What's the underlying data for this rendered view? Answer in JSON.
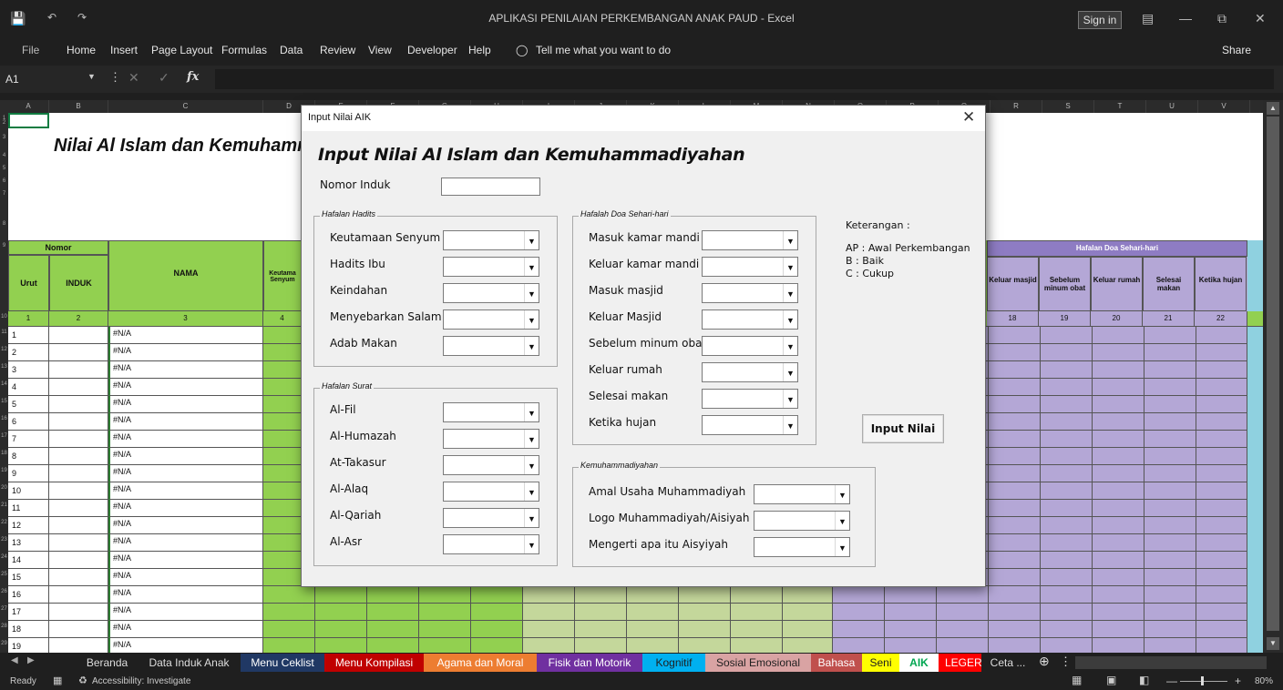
{
  "window": {
    "title": "APLIKASI PENILAIAN PERKEMBANGAN ANAK PAUD  -  Excel",
    "signin": "Sign in",
    "share": "Share"
  },
  "ribbon": {
    "tabs": [
      "File",
      "Home",
      "Insert",
      "Page Layout",
      "Formulas",
      "Data",
      "Review",
      "View",
      "Developer",
      "Help"
    ],
    "tell_me": "Tell me what you want to do"
  },
  "formula_bar": {
    "cell_ref": "A1",
    "fx": "fx"
  },
  "columns": [
    "A",
    "B",
    "C",
    "D",
    "E",
    "F",
    "G",
    "H",
    "I",
    "J",
    "K",
    "L",
    "M",
    "N",
    "O",
    "P",
    "Q",
    "R",
    "S",
    "T",
    "U",
    "V"
  ],
  "sheet": {
    "title": "Nilai Al Islam dan Kemuhammadiyahan",
    "hdr_nomor": "Nomor",
    "hdr_urut": "Urut",
    "hdr_induk": "INDUK",
    "hdr_nama": "NAMA",
    "hdr_d": "Keutama Senyum",
    "hdr_doa": "Hafalan Doa Sehari-hari",
    "doa_cols": [
      "Keluar masjid",
      "Sebelum minum obat",
      "Keluar rumah",
      "Selesai makan",
      "Ketika hujan"
    ],
    "num_row": [
      "1",
      "2",
      "3",
      "4",
      "18",
      "19",
      "20",
      "21",
      "22"
    ],
    "na_value": "#N/A",
    "row_numbers": [
      "1",
      "2",
      "3",
      "4",
      "5",
      "6",
      "7",
      "8",
      "9",
      "10",
      "11",
      "12",
      "13",
      "14",
      "15",
      "16",
      "17",
      "18",
      "19",
      "20",
      "21",
      "22",
      "23",
      "24",
      "25",
      "26",
      "27",
      "28",
      "29"
    ],
    "urut": [
      "1",
      "2",
      "3",
      "4",
      "5",
      "6",
      "7",
      "8",
      "9",
      "10",
      "11",
      "12",
      "13",
      "14",
      "15",
      "16",
      "17",
      "18",
      "19"
    ]
  },
  "tabs": [
    {
      "label": "Beranda",
      "bg": "#1f1f1f",
      "fg": "#dddddd"
    },
    {
      "label": "Data Induk Anak",
      "bg": "#1f1f1f",
      "fg": "#dddddd"
    },
    {
      "label": "Menu Ceklist",
      "bg": "#203864",
      "fg": "#ffffff"
    },
    {
      "label": "Menu Kompilasi",
      "bg": "#c00000",
      "fg": "#ffffff"
    },
    {
      "label": "Agama dan Moral",
      "bg": "#ed7d31",
      "fg": "#ffffff"
    },
    {
      "label": "Fisik dan Motorik",
      "bg": "#7030a0",
      "fg": "#ffffff"
    },
    {
      "label": "Kognitif",
      "bg": "#00b0f0",
      "fg": "#1f1f1f"
    },
    {
      "label": "Sosial Emosional",
      "bg": "#d9a3a3",
      "fg": "#1f1f1f"
    },
    {
      "label": "Bahasa",
      "bg": "#c0504d",
      "fg": "#ffffff"
    },
    {
      "label": "Seni",
      "bg": "#ffff00",
      "fg": "#1f1f1f"
    },
    {
      "label": "AIK",
      "bg": "#ffffff",
      "fg": "#00a651"
    },
    {
      "label": "LEGER",
      "bg": "#ff0000",
      "fg": "#ffffff"
    },
    {
      "label": "Ceta ...",
      "bg": "#1f1f1f",
      "fg": "#dddddd"
    }
  ],
  "status": {
    "ready": "Ready",
    "accessibility": "Accessibility: Investigate",
    "zoom": "80%"
  },
  "dialog": {
    "title": "Input Nilai AIK",
    "heading": "Input Nilai Al Islam dan Kemuhammadiyahan",
    "nomor_induk_label": "Nomor Induk",
    "hadits": {
      "legend": "Hafalan Hadits",
      "items": [
        "Keutamaan Senyum",
        "Hadits Ibu",
        "Keindahan",
        "Menyebarkan Salam",
        "Adab Makan"
      ]
    },
    "surat": {
      "legend": "Hafalan Surat",
      "items": [
        "Al-Fil",
        "Al-Humazah",
        "At-Takasur",
        "Al-Alaq",
        "Al-Qariah",
        "Al-Asr"
      ]
    },
    "doa": {
      "legend": "Hafalah Doa Sehari-hari",
      "items": [
        "Masuk kamar mandi",
        "Keluar kamar mandi",
        "Masuk masjid",
        "Keluar Masjid",
        "Sebelum minum obat",
        "Keluar rumah",
        "Selesai makan",
        "Ketika hujan"
      ]
    },
    "kemuh": {
      "legend": "Kemuhammadiyahan",
      "items": [
        "Amal Usaha Muhammadiyah",
        "Logo Muhammadiyah/Aisiyah",
        "Mengerti apa itu Aisyiyah"
      ]
    },
    "keterangan": {
      "title": "Keterangan :",
      "lines": [
        "AP : Awal Perkembangan",
        "B   : Baik",
        "C   : Cukup"
      ]
    },
    "button": "Input Nilai"
  }
}
